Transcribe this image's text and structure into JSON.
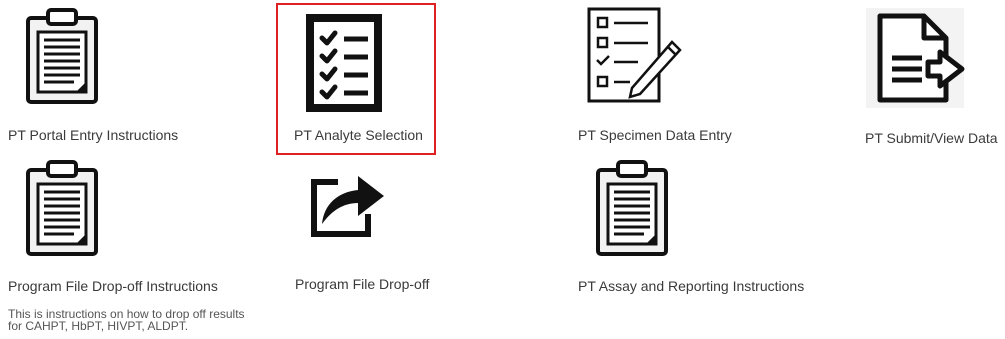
{
  "tiles": {
    "portal_entry": {
      "label": "PT Portal Entry Instructions",
      "icon": "clipboard-icon"
    },
    "analyte_selection": {
      "label": "PT Analyte Selection",
      "icon": "checklist-icon",
      "selected": true
    },
    "specimen_data_entry": {
      "label": "PT Specimen Data Entry",
      "icon": "checklist-pen-icon"
    },
    "submit_view_data": {
      "label": "PT Submit/View Data",
      "icon": "document-arrow-icon"
    },
    "program_file_instructions": {
      "label": "Program File Drop-off Instructions",
      "icon": "clipboard-icon",
      "description_line1": "This is instructions on how to drop off results",
      "description_line2": "for CAHPT,  HbPT, HIVPT, ALDPT."
    },
    "program_file_dropoff": {
      "label": "Program File Drop-off",
      "icon": "share-arrow-icon"
    },
    "assay_reporting": {
      "label": "PT Assay and Reporting Instructions",
      "icon": "clipboard-icon"
    }
  },
  "colors": {
    "highlight": "#e02020",
    "icon": "#111111",
    "background": "#ffffff"
  }
}
